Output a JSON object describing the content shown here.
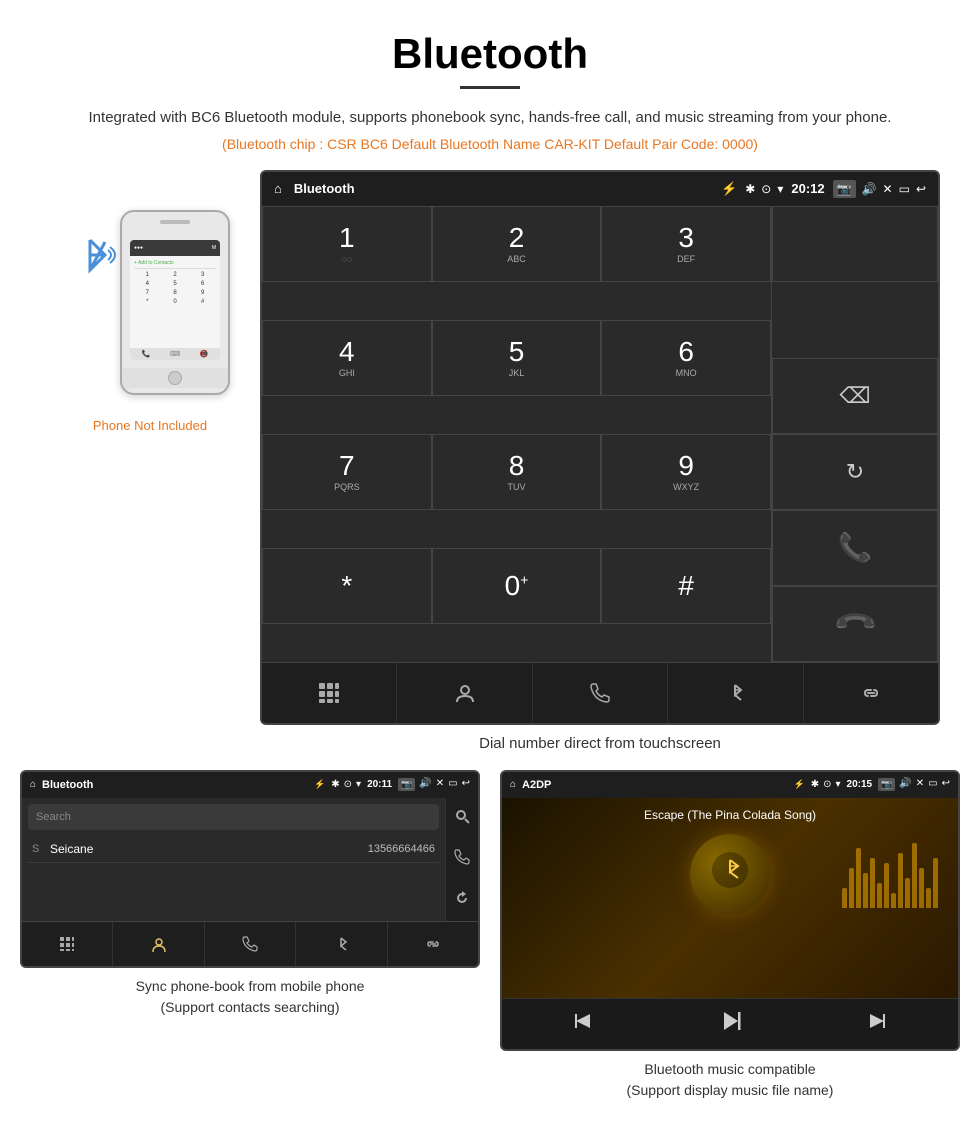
{
  "page": {
    "title": "Bluetooth",
    "subtitle": "Integrated with BC6 Bluetooth module, supports phonebook sync, hands-free call, and music streaming from your phone.",
    "specs": "(Bluetooth chip : CSR BC6    Default Bluetooth Name CAR-KIT    Default Pair Code: 0000)",
    "phone_not_included": "Phone Not Included",
    "dial_caption": "Dial number direct from touchscreen",
    "bottom_left_caption": "Sync phone-book from mobile phone\n(Support contacts searching)",
    "bottom_right_caption": "Bluetooth music compatible\n(Support display music file name)"
  },
  "dialer_screen": {
    "statusbar": {
      "home_icon": "⌂",
      "title": "Bluetooth",
      "usb_icon": "⚡",
      "time": "20:12"
    },
    "keys": [
      {
        "num": "1",
        "sub": "◌◌"
      },
      {
        "num": "2",
        "sub": "ABC"
      },
      {
        "num": "3",
        "sub": "DEF"
      },
      {
        "num": "4",
        "sub": "GHI"
      },
      {
        "num": "5",
        "sub": "JKL"
      },
      {
        "num": "6",
        "sub": "MNO"
      },
      {
        "num": "7",
        "sub": "PQRS"
      },
      {
        "num": "8",
        "sub": "TUV"
      },
      {
        "num": "9",
        "sub": "WXYZ"
      },
      {
        "num": "*",
        "sub": ""
      },
      {
        "num": "0",
        "sub": "+"
      },
      {
        "num": "#",
        "sub": ""
      }
    ],
    "bottom_icons": [
      "⊞",
      "👤",
      "📞",
      "✱",
      "🔗"
    ]
  },
  "phonebook_screen": {
    "statusbar_title": "Bluetooth",
    "statusbar_time": "20:11",
    "search_placeholder": "Search",
    "contacts": [
      {
        "letter": "S",
        "name": "Seicane",
        "number": "13566664466"
      }
    ],
    "bottom_icons": [
      "⊞",
      "👤",
      "📞",
      "✱",
      "🔗"
    ]
  },
  "music_screen": {
    "statusbar_title": "A2DP",
    "statusbar_time": "20:15",
    "song_title": "Escape (The Pina Colada Song)",
    "controls": [
      "⏮",
      "⏭",
      "⏮"
    ]
  },
  "colors": {
    "orange": "#e87722",
    "green": "#4caf50",
    "red": "#f44336",
    "blue": "#4a90d9"
  }
}
